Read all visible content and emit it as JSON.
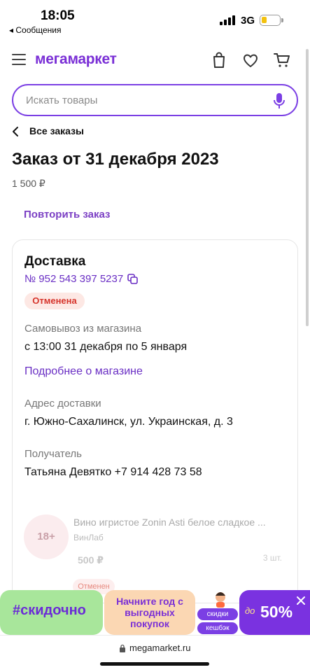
{
  "status_bar": {
    "time": "18:05",
    "back_app": "◂ Сообщения",
    "network": "3G"
  },
  "header": {
    "logo": "мегамаркет",
    "icons": [
      "menu-icon",
      "bag-icon",
      "heart-icon",
      "cart-icon"
    ]
  },
  "search": {
    "placeholder": "Искать товары"
  },
  "breadcrumb": {
    "label": "Все заказы"
  },
  "order": {
    "title": "Заказ от 31 декабря 2023",
    "amount": "1 500 ₽",
    "repeat_label": "Повторить заказ"
  },
  "delivery": {
    "heading": "Доставка",
    "number": "№ 952 543 397 5237",
    "status": "Отменена",
    "pickup_label": "Самовывоз из магазина",
    "pickup_time": "с 13:00 31 декабря по 5 января",
    "store_link": "Подробнее о магазине",
    "address_label": "Адрес доставки",
    "address": "г. Южно-Сахалинск, ул. Украинская, д. 3",
    "recipient_label": "Получатель",
    "recipient": "Татьяна Девятко +7 914 428 73 58"
  },
  "product": {
    "age": "18+",
    "name": "Вино игристое Zonin Asti белое сладкое ...",
    "shop": "ВинЛаб",
    "price": "500 ₽",
    "qty": "3 шт.",
    "status": "Отменен"
  },
  "banner": {
    "green_text": "#скидочно",
    "orange_text": "Начните год с выгодных покупок",
    "pill_discounts": "скидки",
    "pill_cashback": "кешбэк",
    "prefix": "до",
    "percent": "50%"
  },
  "browser": {
    "url": "megamarket.ru"
  },
  "colors": {
    "brand": "#7a2fd6",
    "status_cancel": "#d6342b"
  }
}
